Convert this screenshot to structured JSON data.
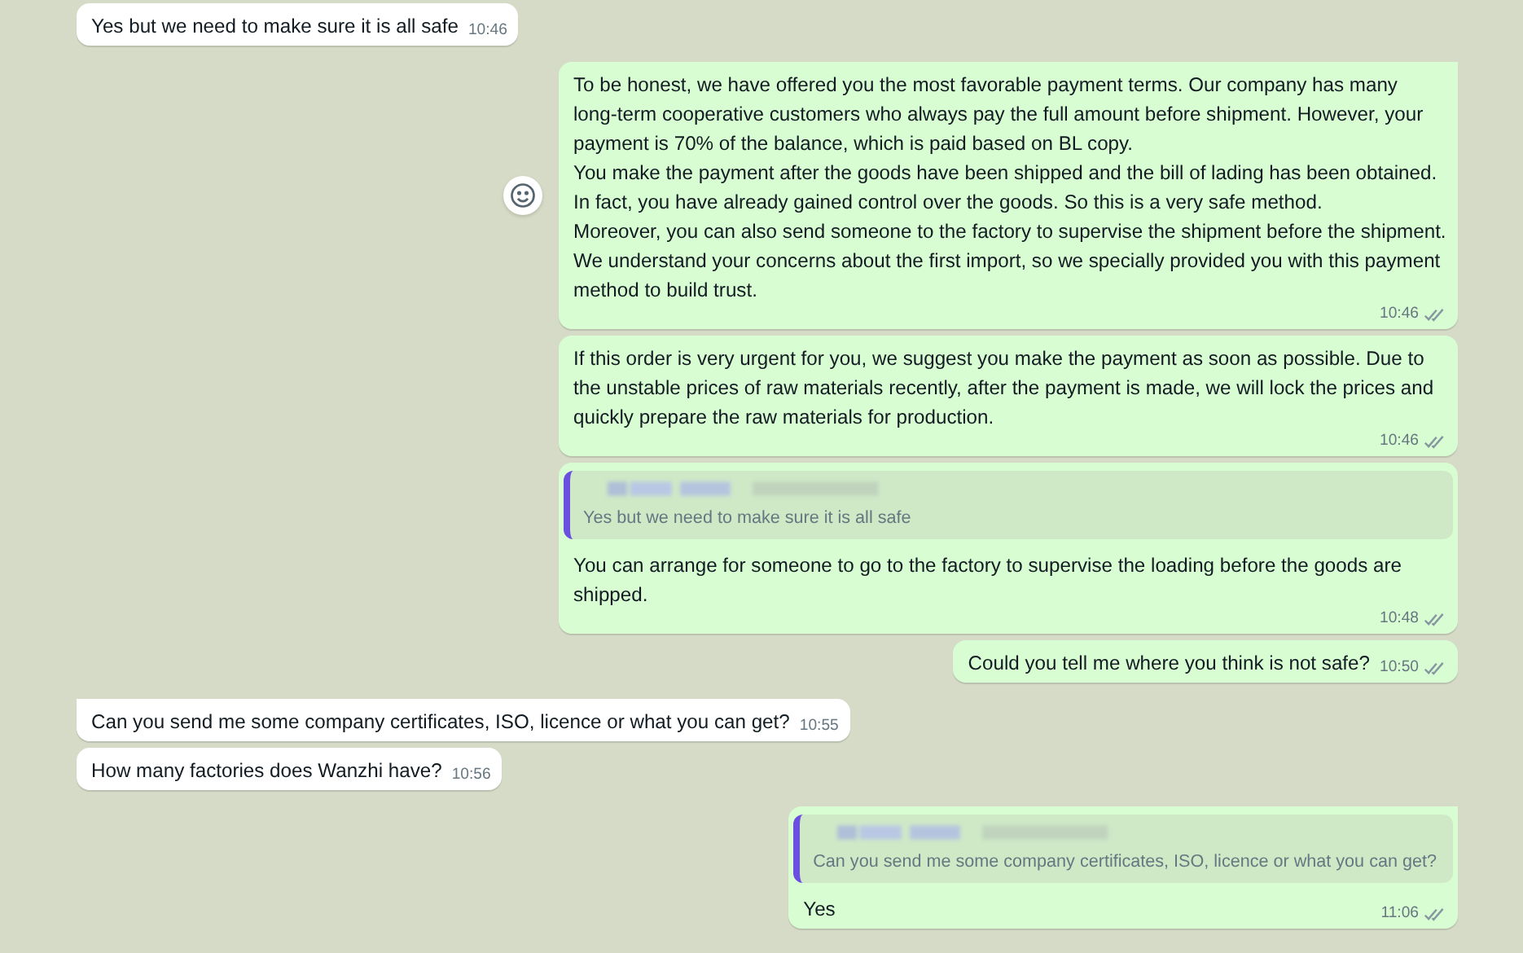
{
  "messages": [
    {
      "kind": "incoming",
      "tail": false,
      "text": "Yes but we need to make sure it is all safe",
      "time": "10:46"
    },
    {
      "kind": "outgoing",
      "tail": true,
      "reaction_button": true,
      "text": "To be honest, we have offered you the most favorable payment terms. Our company has many long-term cooperative customers who always pay the full amount before shipment. However, your payment is 70% of the balance, which is paid based on BL copy.\nYou make the payment after the goods have been shipped and the bill of lading has been obtained. In fact, you have already gained control over the goods. So this is a very safe method.\nMoreover, you can also send someone to the factory to supervise the shipment before the shipment. We understand your concerns about the first import, so we specially provided you with this payment method to build trust.",
      "time": "10:46",
      "read": false
    },
    {
      "kind": "outgoing",
      "tail": false,
      "text": "If this order is very urgent for you, we suggest you make the payment as soon as possible. Due to the unstable prices of raw materials recently, after the payment is made, we will lock the prices and quickly prepare the raw materials for production.",
      "time": "10:46",
      "read": false
    },
    {
      "kind": "outgoing",
      "tail": false,
      "quote": {
        "text": "Yes but we need to make sure it is all safe"
      },
      "text": "You can arrange for someone to go to the factory to supervise the loading before the goods are shipped.",
      "time": "10:48",
      "read": false
    },
    {
      "kind": "outgoing",
      "tail": false,
      "text": "Could you tell me where you think is not safe?",
      "time": "10:50",
      "read": false
    },
    {
      "kind": "incoming",
      "tail": true,
      "text": "Can you send me some company certificates, ISO, licence or what you can get?",
      "time": "10:55"
    },
    {
      "kind": "incoming",
      "tail": false,
      "text": "How many factories does Wanzhi have?",
      "time": "10:56"
    },
    {
      "kind": "outgoing",
      "tail": true,
      "quote": {
        "text": "Can you send me some company certificates, ISO, licence or what you can get?"
      },
      "text": "Yes",
      "time": "11:06",
      "read": false
    }
  ]
}
